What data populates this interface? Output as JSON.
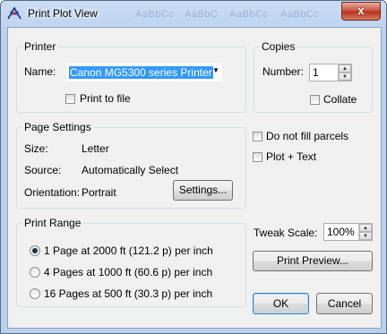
{
  "window": {
    "title": "Print Plot View",
    "background_tabs": [
      "AaBbCc",
      "AaBbC",
      "AaBbCc",
      "AaBbCc"
    ],
    "close_label": "x"
  },
  "printer": {
    "group_label": "Printer",
    "name_label": "Name:",
    "name_value": "Canon MG5300 series Printer",
    "print_to_file_label": "Print to file",
    "print_to_file_checked": false
  },
  "copies": {
    "group_label": "Copies",
    "number_label": "Number:",
    "number_value": "1",
    "collate_label": "Collate",
    "collate_checked": false
  },
  "page_settings": {
    "group_label": "Page Settings",
    "size_label": "Size:",
    "size_value": "Letter",
    "source_label": "Source:",
    "source_value": "Automatically Select",
    "orientation_label": "Orientation:",
    "orientation_value": "Portrait",
    "settings_button": "Settings..."
  },
  "options": {
    "do_not_fill_parcels_label": "Do not fill parcels",
    "do_not_fill_parcels_checked": false,
    "plot_text_label": "Plot + Text",
    "plot_text_checked": false
  },
  "print_range": {
    "group_label": "Print Range",
    "options": [
      {
        "label": "1 Page at 2000 ft (121.2 p) per inch",
        "selected": true
      },
      {
        "label": "4 Pages at 1000 ft (60.6 p) per inch",
        "selected": false
      },
      {
        "label": "16 Pages at 500 ft (30.3 p) per inch",
        "selected": false
      }
    ]
  },
  "tweak": {
    "label": "Tweak Scale:",
    "value": "100%"
  },
  "buttons": {
    "print_preview": "Print Preview...",
    "ok": "OK",
    "cancel": "Cancel"
  },
  "colors": {
    "selection": "#3399ff",
    "title_bar": "#b9d1ee",
    "close_button": "#c6513c"
  }
}
